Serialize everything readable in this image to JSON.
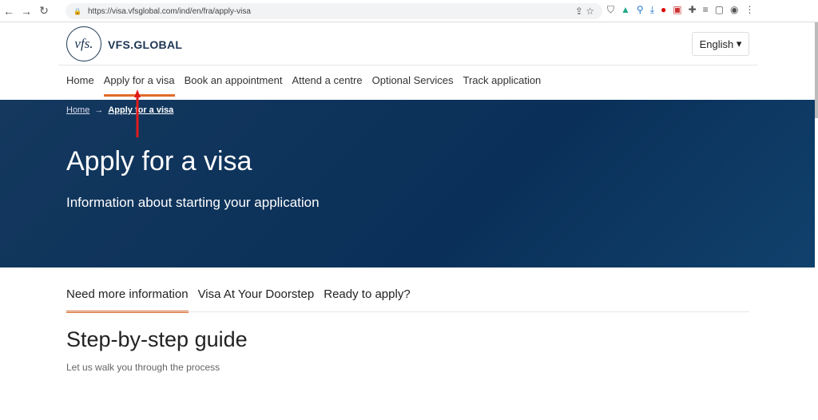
{
  "browser": {
    "url": "https://visa.vfsglobal.com/ind/en/fra/apply-visa"
  },
  "header": {
    "logo_text": "vfs.",
    "brand": "VFS.GLOBAL",
    "language": "English"
  },
  "nav": [
    "Home",
    "Apply for a visa",
    "Book an appointment",
    "Attend a centre",
    "Optional Services",
    "Track application"
  ],
  "breadcrumb": {
    "home": "Home",
    "current": "Apply for a visa"
  },
  "hero": {
    "title": "Apply for a visa",
    "subtitle": "Information about starting your application"
  },
  "tabs": [
    "Need more information",
    "Visa At Your Doorstep",
    "Ready to apply?"
  ],
  "section": {
    "title": "Step-by-step guide",
    "text": "Let us walk you through the process"
  },
  "colors": {
    "accent": "#e06b2a",
    "hero": "#0a3059",
    "arrow": "#e01b1b"
  }
}
